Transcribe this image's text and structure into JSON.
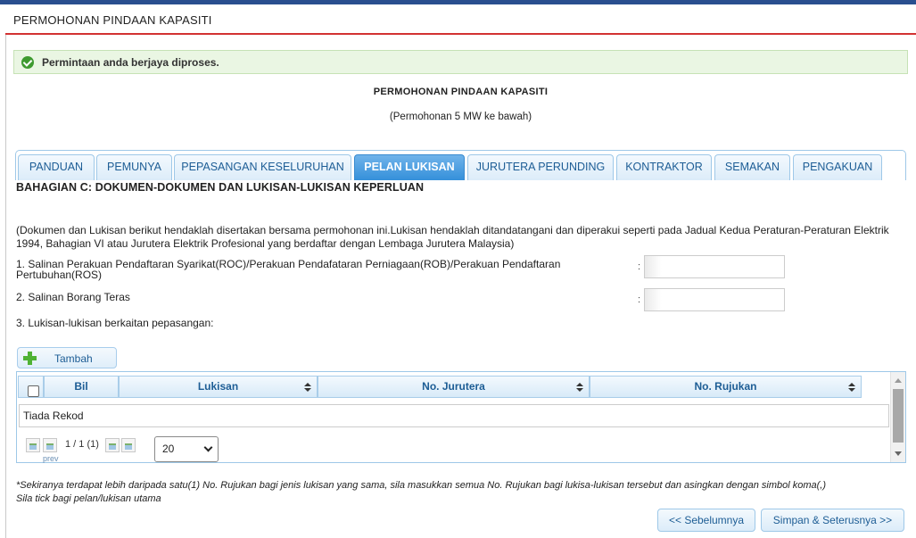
{
  "header": {
    "title": "PERMOHONAN PINDAAN KAPASITI"
  },
  "alert": {
    "message": "Permintaan anda berjaya diproses."
  },
  "content": {
    "title": "PERMOHONAN PINDAAN KAPASITI",
    "subtitle": "(Permohonan 5 MW ke bawah)"
  },
  "tabs": [
    {
      "label": "PANDUAN",
      "active": false
    },
    {
      "label": "PEMUNYA",
      "active": false
    },
    {
      "label": "PEPASANGAN KESELURUHAN",
      "active": false
    },
    {
      "label": "PELAN LUKISAN",
      "active": true
    },
    {
      "label": "JURUTERA PERUNDING",
      "active": false
    },
    {
      "label": "KONTRAKTOR",
      "active": false
    },
    {
      "label": "SEMAKAN",
      "active": false
    },
    {
      "label": "PENGAKUAN",
      "active": false
    }
  ],
  "section": {
    "heading": "BAHAGIAN C: DOKUMEN-DOKUMEN DAN LUKISAN-LUKISAN KEPERLUAN",
    "description": "(Dokumen dan Lukisan berikut hendaklah disertakan bersama permohonan ini.Lukisan hendaklah ditandatangani dan diperakui seperti pada Jadual Kedua Peraturan-Peraturan Elektrik 1994, Bahagian VI atau Jurutera Elektrik Profesional yang berdaftar dengan Lembaga Jurutera Malaysia)",
    "items": [
      {
        "label": "1. Salinan Perakuan Pendaftaran Syarikat(ROC)/Perakuan Pendafataran Perniagaan(ROB)/Perakuan Pendaftaran Pertubuhan(ROS)",
        "colon": ":",
        "value": ""
      },
      {
        "label": "2. Salinan Borang Teras",
        "colon": ":",
        "value": ""
      }
    ],
    "item3": "3. Lukisan-lukisan berkaitan pepasangan:"
  },
  "add_button": {
    "label": "Tambah"
  },
  "grid": {
    "columns": [
      "Bil",
      "Lukisan",
      "No. Jurutera",
      "No. Rujukan"
    ],
    "empty_text": "Tiada Rekod",
    "pager": {
      "text": "1 / 1 (1)",
      "prev_label": "prev",
      "page_size": "20"
    }
  },
  "note": {
    "line1": "*Sekiranya terdapat lebih daripada satu(1) No. Rujukan bagi jenis lukisan yang sama, sila masukkan semua No. Rujukan bagi lukisa-lukisan tersebut dan asingkan dengan simbol koma(,)",
    "line2": "Sila tick bagi pelan/lukisan utama"
  },
  "buttons": {
    "back": "<< Sebelumnya",
    "next": "Simpan & Seterusnya >>"
  }
}
